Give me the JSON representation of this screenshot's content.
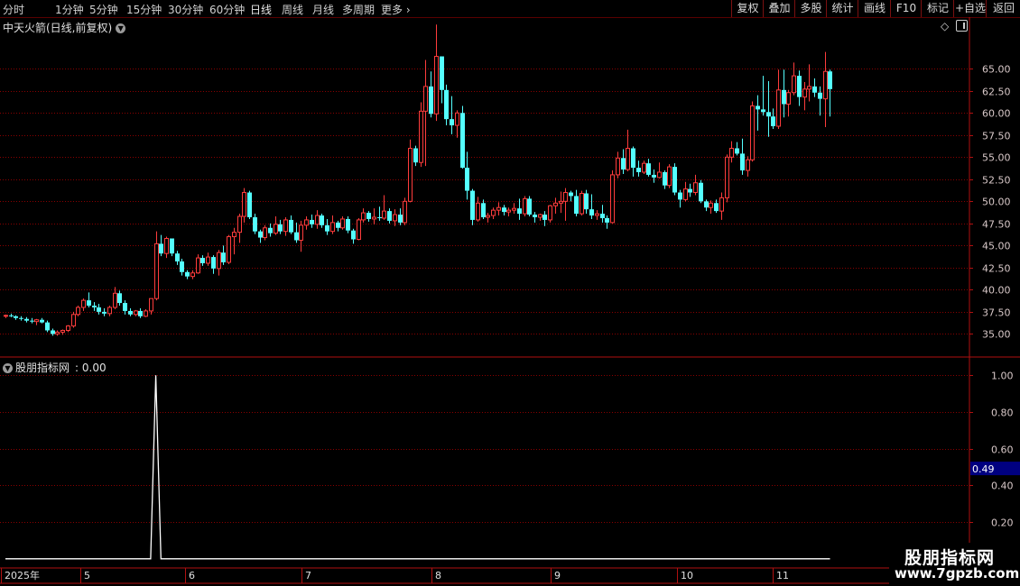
{
  "toolbar": {
    "periods": [
      "分时",
      "1分钟",
      "5分钟",
      "15分钟",
      "30分钟",
      "60分钟",
      "日线",
      "周线",
      "月线",
      "多周期",
      "更多"
    ],
    "active_period": "日线",
    "right_buttons": [
      "复权",
      "叠加",
      "多股",
      "统计",
      "画线",
      "F10",
      "标记",
      "+自选",
      "返回"
    ]
  },
  "chart_title": "中天火箭(日线,前复权)",
  "indicator": {
    "name": "股朋指标网",
    "value_text": ": 0.00",
    "cursor_value": "0.49"
  },
  "watermark": {
    "line1": "股朋指标网",
    "line2": "www.7gpzb.com"
  },
  "colors": {
    "up": "#ff3c3c",
    "down": "#54ffff",
    "grid": "#8a0000",
    "axis": "#b01010",
    "cursor": "#000080"
  },
  "icons": [
    "dropdown-icon",
    "diamond-icon",
    "panel-toggle-icon"
  ],
  "chart_data": [
    {
      "type": "candlestick",
      "title": "中天火箭(日线,前复权)",
      "y_ticks": [
        "65.00",
        "62.50",
        "60.00",
        "57.50",
        "55.00",
        "52.50",
        "50.00",
        "47.50",
        "45.00",
        "42.50",
        "40.00",
        "37.50",
        "35.00"
      ],
      "ylim": [
        33.0,
        68.7
      ],
      "x_tick_labels": [
        "2025年",
        "5",
        "6",
        "7",
        "8",
        "9",
        "10",
        "11"
      ],
      "grid": true,
      "candles": [
        [
          37.0,
          37.2,
          36.8,
          37.1
        ],
        [
          37.1,
          37.3,
          36.9,
          37.0
        ],
        [
          37.0,
          37.1,
          36.6,
          36.8
        ],
        [
          36.8,
          37.0,
          36.5,
          36.7
        ],
        [
          36.7,
          36.9,
          36.3,
          36.5
        ],
        [
          36.5,
          36.8,
          36.2,
          36.4
        ],
        [
          36.4,
          36.7,
          36.0,
          36.6
        ],
        [
          36.6,
          36.8,
          36.2,
          36.3
        ],
        [
          36.3,
          36.5,
          35.2,
          35.4
        ],
        [
          35.4,
          35.6,
          34.8,
          35.0
        ],
        [
          35.0,
          35.4,
          34.8,
          35.2
        ],
        [
          35.2,
          35.5,
          34.9,
          35.4
        ],
        [
          35.4,
          36.0,
          35.2,
          35.9
        ],
        [
          35.9,
          37.5,
          35.7,
          37.2
        ],
        [
          37.2,
          38.2,
          37.0,
          38.0
        ],
        [
          38.0,
          39.0,
          37.6,
          38.8
        ],
        [
          38.8,
          39.7,
          38.0,
          38.2
        ],
        [
          38.2,
          38.6,
          37.6,
          38.0
        ],
        [
          38.0,
          38.4,
          37.2,
          37.5
        ],
        [
          37.5,
          37.9,
          37.0,
          37.3
        ],
        [
          37.3,
          38.2,
          37.0,
          38.0
        ],
        [
          38.0,
          40.3,
          37.8,
          39.6
        ],
        [
          39.6,
          39.9,
          38.2,
          38.5
        ],
        [
          38.5,
          38.8,
          37.2,
          37.6
        ],
        [
          37.6,
          37.9,
          37.0,
          37.2
        ],
        [
          37.2,
          37.7,
          37.0,
          37.6
        ],
        [
          37.6,
          37.9,
          36.8,
          37.0
        ],
        [
          37.0,
          37.8,
          36.9,
          37.6
        ],
        [
          37.6,
          39.0,
          37.2,
          39.0
        ],
        [
          39.0,
          46.6,
          38.8,
          45.2
        ],
        [
          45.2,
          46.2,
          43.8,
          44.1
        ],
        [
          44.1,
          46.0,
          43.6,
          45.8
        ],
        [
          45.8,
          45.8,
          43.8,
          44.1
        ],
        [
          44.1,
          44.4,
          42.8,
          43.2
        ],
        [
          43.2,
          43.5,
          41.6,
          42.0
        ],
        [
          42.0,
          42.2,
          41.2,
          41.5
        ],
        [
          41.5,
          42.2,
          41.2,
          41.9
        ],
        [
          41.9,
          44.0,
          41.8,
          43.6
        ],
        [
          43.6,
          43.9,
          42.7,
          43.0
        ],
        [
          43.0,
          44.2,
          42.7,
          43.7
        ],
        [
          43.7,
          43.9,
          41.8,
          42.4
        ],
        [
          42.4,
          44.5,
          41.6,
          44.2
        ],
        [
          44.2,
          45.0,
          42.8,
          43.1
        ],
        [
          43.1,
          46.2,
          42.9,
          46.0
        ],
        [
          46.0,
          47.0,
          44.0,
          46.5
        ],
        [
          46.5,
          48.6,
          45.3,
          48.3
        ],
        [
          48.3,
          51.5,
          47.6,
          51.0
        ],
        [
          51.0,
          51.2,
          48.0,
          48.2
        ],
        [
          48.2,
          48.6,
          46.3,
          46.6
        ],
        [
          46.6,
          46.8,
          45.3,
          45.9
        ],
        [
          45.9,
          47.3,
          45.6,
          47.0
        ],
        [
          47.0,
          47.5,
          46.0,
          46.4
        ],
        [
          46.4,
          48.3,
          46.2,
          47.4
        ],
        [
          47.4,
          47.9,
          46.3,
          46.6
        ],
        [
          46.6,
          48.2,
          46.1,
          47.9
        ],
        [
          47.9,
          48.4,
          46.3,
          46.5
        ],
        [
          46.5,
          47.6,
          45.3,
          45.6
        ],
        [
          45.6,
          47.8,
          44.3,
          47.3
        ],
        [
          47.3,
          48.3,
          46.8,
          47.9
        ],
        [
          47.9,
          48.5,
          47.0,
          47.4
        ],
        [
          47.4,
          49.0,
          46.9,
          48.4
        ],
        [
          48.4,
          48.6,
          47.0,
          47.3
        ],
        [
          47.3,
          48.0,
          46.2,
          46.6
        ],
        [
          46.6,
          48.4,
          46.3,
          47.6
        ],
        [
          47.6,
          47.8,
          46.6,
          47.0
        ],
        [
          47.0,
          48.3,
          46.8,
          48.0
        ],
        [
          48.0,
          48.3,
          46.4,
          46.7
        ],
        [
          46.7,
          46.9,
          45.2,
          45.7
        ],
        [
          45.7,
          48.1,
          45.6,
          47.9
        ],
        [
          47.9,
          49.2,
          47.6,
          48.7
        ],
        [
          48.7,
          48.9,
          47.7,
          48.0
        ],
        [
          48.0,
          49.2,
          47.4,
          48.2
        ],
        [
          48.2,
          49.4,
          47.8,
          48.1
        ],
        [
          48.1,
          50.7,
          47.9,
          48.9
        ],
        [
          48.9,
          49.2,
          47.5,
          47.8
        ],
        [
          47.8,
          49.1,
          47.2,
          48.5
        ],
        [
          48.5,
          49.2,
          47.3,
          47.6
        ],
        [
          47.6,
          50.4,
          47.3,
          50.0
        ],
        [
          50.0,
          57.0,
          49.9,
          56.0
        ],
        [
          56.0,
          56.3,
          54.0,
          54.4
        ],
        [
          54.4,
          61.2,
          53.9,
          60.2
        ],
        [
          60.2,
          66.0,
          54.0,
          63.0
        ],
        [
          63.0,
          64.7,
          59.5,
          59.9
        ],
        [
          59.9,
          70.0,
          59.1,
          66.4
        ],
        [
          66.4,
          66.4,
          61.1,
          62.6
        ],
        [
          62.6,
          63.2,
          58.6,
          59.3
        ],
        [
          59.3,
          61.9,
          57.6,
          58.6
        ],
        [
          58.6,
          60.3,
          57.2,
          60.0
        ],
        [
          60.0,
          60.8,
          53.7,
          53.8
        ],
        [
          53.8,
          55.6,
          50.2,
          51.2
        ],
        [
          51.2,
          51.4,
          47.3,
          47.9
        ],
        [
          47.9,
          50.5,
          47.7,
          49.8
        ],
        [
          49.8,
          50.2,
          48.0,
          48.2
        ],
        [
          48.2,
          48.7,
          47.6,
          48.4
        ],
        [
          48.4,
          49.3,
          48.0,
          49.0
        ],
        [
          49.0,
          49.9,
          48.4,
          49.3
        ],
        [
          49.3,
          49.6,
          48.4,
          48.8
        ],
        [
          48.8,
          49.3,
          48.3,
          49.0
        ],
        [
          49.0,
          49.8,
          48.6,
          49.2
        ],
        [
          49.2,
          50.3,
          47.9,
          48.6
        ],
        [
          48.6,
          50.6,
          48.3,
          50.3
        ],
        [
          50.3,
          50.6,
          48.3,
          48.5
        ],
        [
          48.5,
          48.8,
          47.6,
          48.2
        ],
        [
          48.2,
          48.6,
          47.8,
          48.5
        ],
        [
          48.5,
          48.9,
          47.2,
          47.9
        ],
        [
          47.9,
          49.6,
          47.6,
          49.5
        ],
        [
          49.5,
          50.4,
          48.6,
          49.8
        ],
        [
          49.8,
          51.1,
          48.7,
          50.0
        ],
        [
          50.0,
          51.5,
          47.8,
          51.0
        ],
        [
          51.0,
          51.2,
          50.0,
          50.6
        ],
        [
          50.6,
          51.3,
          48.3,
          48.6
        ],
        [
          48.6,
          51.2,
          48.4,
          50.9
        ],
        [
          50.9,
          51.3,
          48.6,
          49.1
        ],
        [
          49.1,
          50.8,
          48.0,
          48.4
        ],
        [
          48.4,
          49.0,
          47.9,
          48.6
        ],
        [
          48.6,
          49.6,
          47.6,
          48.1
        ],
        [
          48.1,
          48.4,
          46.9,
          47.6
        ],
        [
          47.6,
          53.5,
          47.5,
          53.0
        ],
        [
          53.0,
          55.6,
          52.6,
          54.9
        ],
        [
          54.9,
          55.9,
          53.1,
          53.6
        ],
        [
          53.6,
          58.1,
          53.4,
          56.0
        ],
        [
          56.0,
          56.2,
          52.8,
          53.8
        ],
        [
          53.8,
          54.6,
          52.8,
          53.3
        ],
        [
          53.3,
          54.6,
          53.1,
          54.3
        ],
        [
          54.3,
          54.8,
          52.8,
          53.0
        ],
        [
          53.0,
          53.6,
          52.1,
          52.7
        ],
        [
          52.7,
          54.4,
          52.6,
          53.3
        ],
        [
          53.3,
          53.5,
          51.4,
          51.8
        ],
        [
          51.8,
          54.2,
          51.5,
          53.9
        ],
        [
          53.9,
          54.3,
          50.7,
          51.0
        ],
        [
          51.0,
          51.3,
          49.3,
          50.2
        ],
        [
          50.2,
          52.2,
          50.0,
          51.4
        ],
        [
          51.4,
          52.0,
          50.5,
          51.0
        ],
        [
          51.0,
          53.0,
          50.7,
          52.1
        ],
        [
          52.1,
          52.4,
          49.8,
          50.0
        ],
        [
          50.0,
          50.2,
          48.9,
          49.3
        ],
        [
          49.3,
          50.1,
          48.6,
          49.8
        ],
        [
          49.8,
          50.2,
          48.7,
          48.9
        ],
        [
          48.9,
          51.0,
          47.9,
          50.4
        ],
        [
          50.4,
          55.3,
          49.9,
          55.0
        ],
        [
          55.0,
          56.8,
          54.4,
          56.0
        ],
        [
          56.0,
          56.7,
          55.2,
          55.4
        ],
        [
          55.4,
          57.1,
          53.0,
          53.5
        ],
        [
          53.5,
          55.1,
          52.8,
          54.7
        ],
        [
          54.7,
          61.3,
          54.5,
          60.8
        ],
        [
          60.8,
          62.0,
          58.0,
          60.4
        ],
        [
          60.4,
          64.2,
          59.7,
          60.1
        ],
        [
          60.1,
          63.6,
          57.3,
          59.6
        ],
        [
          59.6,
          60.5,
          58.2,
          58.5
        ],
        [
          58.5,
          64.9,
          58.2,
          62.6
        ],
        [
          62.6,
          64.9,
          59.5,
          61.0
        ],
        [
          61.0,
          62.6,
          59.6,
          62.3
        ],
        [
          62.3,
          65.7,
          62.0,
          64.2
        ],
        [
          64.2,
          64.8,
          60.8,
          61.8
        ],
        [
          61.8,
          63.5,
          60.3,
          62.7
        ],
        [
          62.7,
          65.5,
          61.3,
          63.0
        ],
        [
          63.0,
          63.9,
          61.8,
          62.3
        ],
        [
          62.3,
          63.0,
          59.7,
          61.6
        ],
        [
          61.6,
          66.9,
          58.4,
          64.7
        ],
        [
          64.7,
          64.9,
          59.6,
          62.7
        ]
      ]
    },
    {
      "type": "line",
      "title": "股朋指标网",
      "y_ticks": [
        "1.00",
        "0.80",
        "0.60",
        "0.40",
        "0.20"
      ],
      "ylim": [
        -0.05,
        1.08
      ],
      "signal_index": 29,
      "values_note": "0 everywhere except 1.00 at signal_index"
    }
  ]
}
